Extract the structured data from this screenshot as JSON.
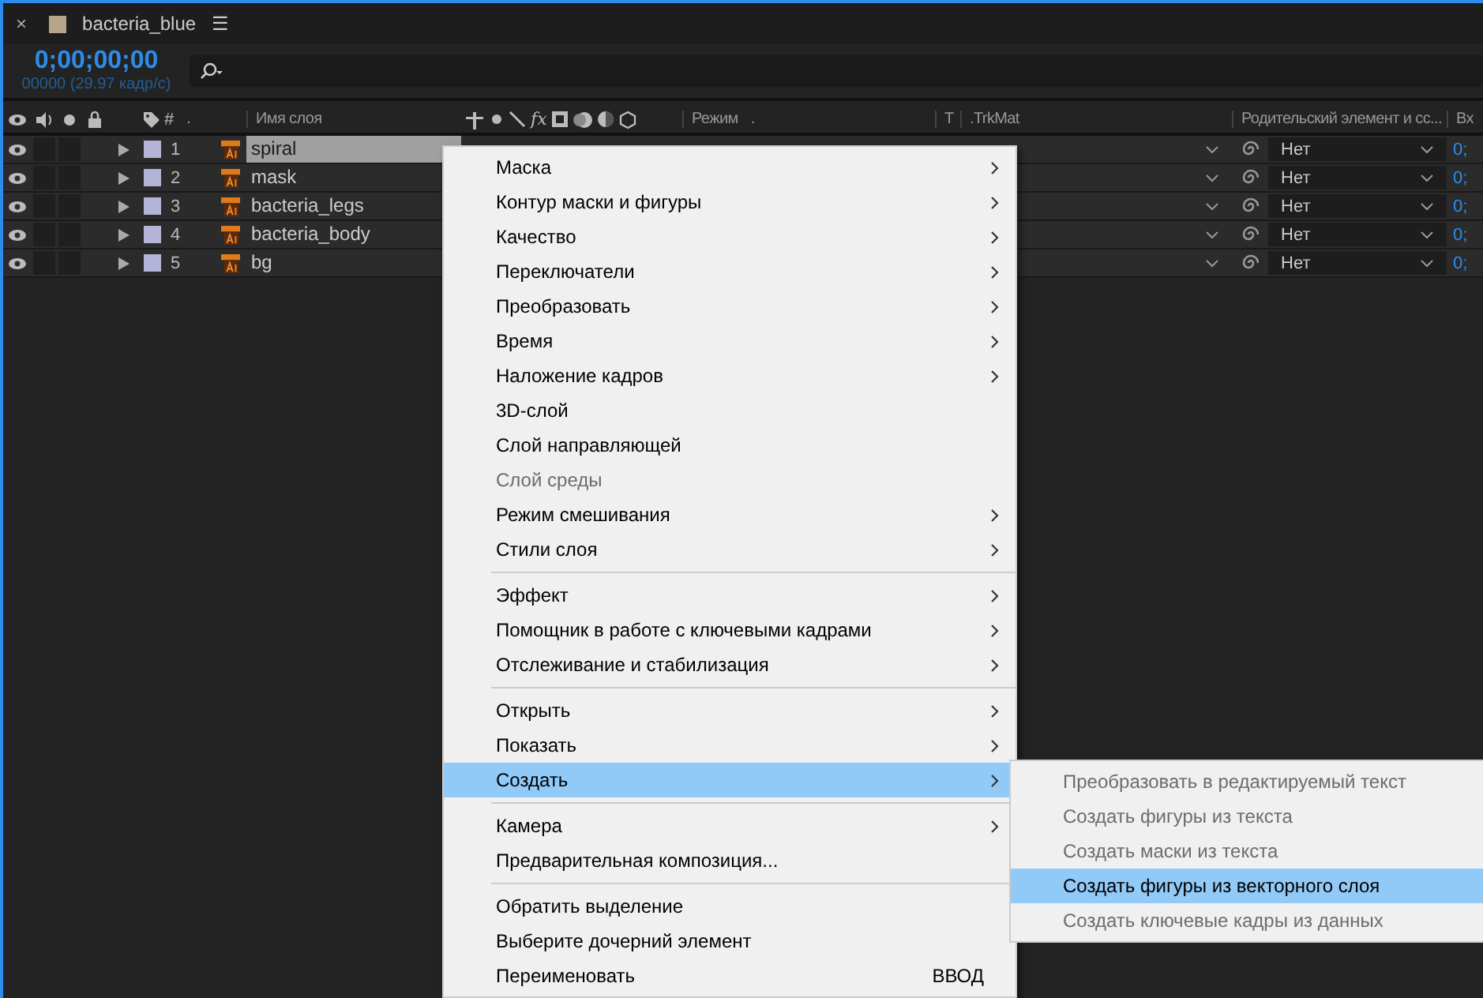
{
  "panel": {
    "title": "bacteria_blue",
    "close": "×",
    "menu": "☰"
  },
  "timecode": "0;00;00;00",
  "frame_info": "00000 (29.97 кадр/с)",
  "columns": {
    "number": "#",
    "dot": ".",
    "name": "Имя слоя",
    "fx": "fx",
    "mode": "Режим",
    "mode_dot": ".",
    "t": "T",
    "trkmat": ".TrkMat",
    "parent": "Родительский элемент и сс...",
    "in": "Вх"
  },
  "layers": [
    {
      "number": "1",
      "name": "spiral",
      "selected": true,
      "parent": "Нет",
      "in": "0;"
    },
    {
      "number": "2",
      "name": "mask",
      "selected": false,
      "parent": "Нет",
      "in": "0;"
    },
    {
      "number": "3",
      "name": "bacteria_legs",
      "selected": false,
      "parent": "Нет",
      "in": "0;"
    },
    {
      "number": "4",
      "name": "bacteria_body",
      "selected": false,
      "parent": "Нет",
      "in": "0;"
    },
    {
      "number": "5",
      "name": "bg",
      "selected": false,
      "parent": "Нет",
      "in": "0;"
    }
  ],
  "context_menu": {
    "sections": [
      [
        {
          "label": "Маска",
          "submenu": true,
          "disabled": false,
          "selected": false
        },
        {
          "label": "Контур маски и фигуры",
          "submenu": true,
          "disabled": false,
          "selected": false
        },
        {
          "label": "Качество",
          "submenu": true,
          "disabled": false,
          "selected": false
        },
        {
          "label": "Переключатели",
          "submenu": true,
          "disabled": false,
          "selected": false
        },
        {
          "label": "Преобразовать",
          "submenu": true,
          "disabled": false,
          "selected": false
        },
        {
          "label": "Время",
          "submenu": true,
          "disabled": false,
          "selected": false
        },
        {
          "label": "Наложение кадров",
          "submenu": true,
          "disabled": false,
          "selected": false
        },
        {
          "label": "3D-слой",
          "submenu": false,
          "disabled": false,
          "selected": false
        },
        {
          "label": "Слой направляющей",
          "submenu": false,
          "disabled": false,
          "selected": false
        },
        {
          "label": "Слой среды",
          "submenu": false,
          "disabled": true,
          "selected": false
        },
        {
          "label": "Режим смешивания",
          "submenu": true,
          "disabled": false,
          "selected": false
        },
        {
          "label": "Стили слоя",
          "submenu": true,
          "disabled": false,
          "selected": false
        }
      ],
      [
        {
          "label": "Эффект",
          "submenu": true,
          "disabled": false,
          "selected": false
        },
        {
          "label": "Помощник в работе с ключевыми кадрами",
          "submenu": true,
          "disabled": false,
          "selected": false
        },
        {
          "label": "Отслеживание и стабилизация",
          "submenu": true,
          "disabled": false,
          "selected": false
        }
      ],
      [
        {
          "label": "Открыть",
          "submenu": true,
          "disabled": false,
          "selected": false
        },
        {
          "label": "Показать",
          "submenu": true,
          "disabled": false,
          "selected": false
        },
        {
          "label": "Создать",
          "submenu": true,
          "disabled": false,
          "selected": true
        }
      ],
      [
        {
          "label": "Камера",
          "submenu": true,
          "disabled": false,
          "selected": false
        },
        {
          "label": "Предварительная композиция...",
          "submenu": false,
          "disabled": false,
          "selected": false
        }
      ],
      [
        {
          "label": "Обратить выделение",
          "submenu": false,
          "disabled": false,
          "selected": false
        },
        {
          "label": "Выберите дочерний элемент",
          "submenu": false,
          "disabled": false,
          "selected": false
        },
        {
          "label": "Переименовать",
          "submenu": false,
          "disabled": false,
          "selected": false,
          "shortcut": "ВВОД"
        }
      ]
    ]
  },
  "submenu": [
    {
      "label": "Преобразовать в редактируемый текст",
      "disabled": true,
      "selected": false
    },
    {
      "label": "Создать фигуры из текста",
      "disabled": true,
      "selected": false
    },
    {
      "label": "Создать маски из текста",
      "disabled": true,
      "selected": false
    },
    {
      "label": "Создать фигуры из векторного слоя",
      "disabled": false,
      "selected": true
    },
    {
      "label": "Создать ключевые кадры из данных",
      "disabled": true,
      "selected": false
    }
  ]
}
